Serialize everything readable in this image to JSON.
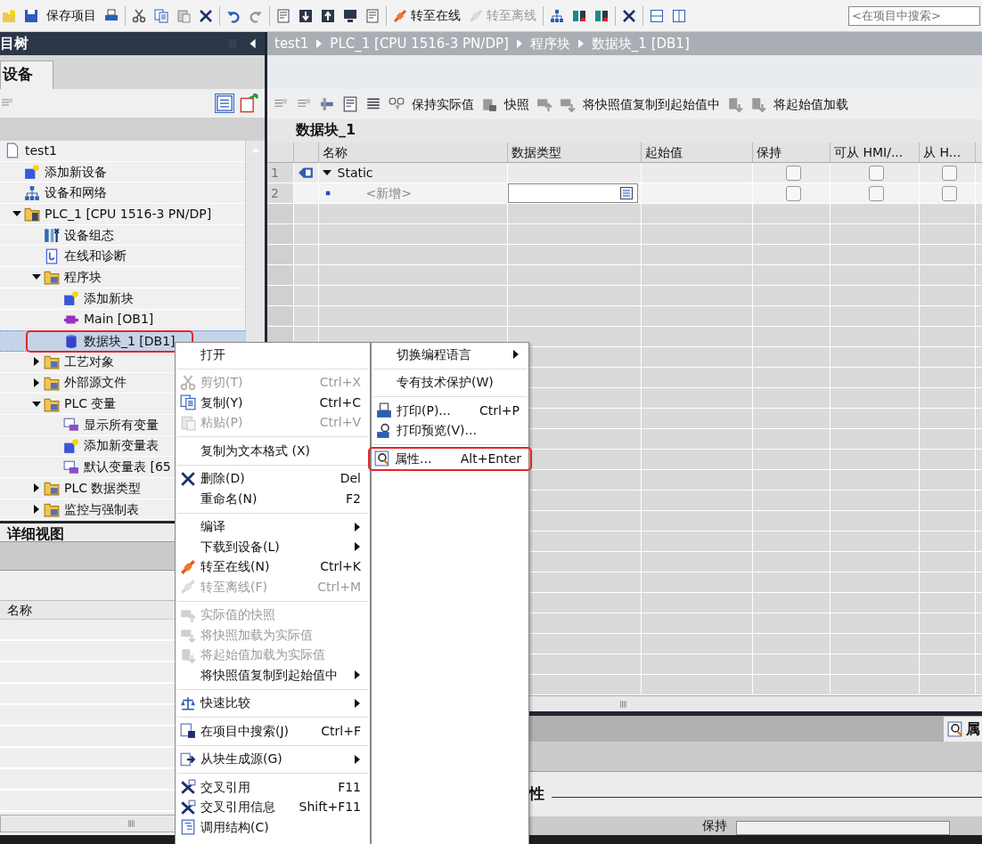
{
  "toolbar": {
    "buttons": [
      {
        "label": "保存项目",
        "disabled": false
      },
      {
        "label": "转至在线",
        "disabled": false
      },
      {
        "label": "转至离线",
        "disabled": true
      }
    ],
    "search": {
      "placeholder": "<在项目中搜索>"
    }
  },
  "project_tree": {
    "title": "目树",
    "tab": "设备",
    "items": [
      {
        "label": "test1",
        "kind": "project",
        "selected": false,
        "children": [
          {
            "label": "添加新设备",
            "kind": "add",
            "selected": false
          },
          {
            "label": "设备和网络",
            "kind": "network",
            "selected": false
          },
          {
            "label": "PLC_1 [CPU 1516-3 PN/DP]",
            "kind": "plc",
            "selected": false,
            "expanded": true,
            "children": [
              {
                "label": "设备组态",
                "kind": "config",
                "selected": false
              },
              {
                "label": "在线和诊断",
                "kind": "diag",
                "selected": false
              },
              {
                "label": "程序块",
                "kind": "folder",
                "selected": false,
                "expanded": true,
                "children": [
                  {
                    "label": "添加新块",
                    "kind": "add",
                    "selected": false
                  },
                  {
                    "label": "Main [OB1]",
                    "kind": "ob",
                    "selected": false
                  },
                  {
                    "label": "数据块_1 [DB1]",
                    "kind": "db",
                    "selected": true,
                    "highlighted": true
                  }
                ]
              },
              {
                "label": "工艺对象",
                "kind": "folder",
                "selected": false,
                "expanded": false
              },
              {
                "label": "外部源文件",
                "kind": "folder",
                "selected": false,
                "expanded": false
              },
              {
                "label": "PLC 变量",
                "kind": "folder",
                "selected": false,
                "expanded": true,
                "children": [
                  {
                    "label": "显示所有变量",
                    "kind": "tags",
                    "selected": false
                  },
                  {
                    "label": "添加新变量表",
                    "kind": "add",
                    "selected": false
                  },
                  {
                    "label": "默认变量表 [65",
                    "kind": "tags",
                    "selected": false
                  }
                ]
              },
              {
                "label": "PLC 数据类型",
                "kind": "folder",
                "selected": false,
                "expanded": false
              },
              {
                "label": "监控与强制表",
                "kind": "folder",
                "selected": false,
                "expanded": false
              }
            ]
          }
        ]
      }
    ]
  },
  "detail_view": {
    "title": "详细视图",
    "columns": [
      "名称"
    ]
  },
  "editor": {
    "breadcrumb": [
      "test1",
      "PLC_1 [CPU 1516-3 PN/DP]",
      "程序块",
      "数据块_1 [DB1]"
    ],
    "toolbar_labels": [
      "保持实际值",
      "快照",
      "将快照值复制到起始值中",
      "将起始值加载"
    ],
    "block_title": "数据块_1",
    "columns": [
      "名称",
      "数据类型",
      "起始值",
      "保持",
      "可从 HMI/...",
      "从 H..."
    ],
    "rows": [
      {
        "number": "1",
        "kind": "struct",
        "name": "Static",
        "expanded": true,
        "retain": false,
        "hmi_access": false,
        "hmi_visible": false
      },
      {
        "number": "2",
        "kind": "new",
        "name": "<新增>",
        "retain": false,
        "hmi_access": false,
        "hmi_visible": false
      }
    ]
  },
  "properties": {
    "tab": "属",
    "heading": "性",
    "field_label": "保持"
  },
  "context_menu": {
    "items": [
      {
        "kind": "item",
        "label": "打开",
        "disabled": false
      },
      {
        "kind": "separator"
      },
      {
        "kind": "item",
        "label": "剪切(T)",
        "shortcut": "Ctrl+X",
        "disabled": true
      },
      {
        "kind": "item",
        "label": "复制(Y)",
        "shortcut": "Ctrl+C",
        "disabled": false
      },
      {
        "kind": "item",
        "label": "粘贴(P)",
        "shortcut": "Ctrl+V",
        "disabled": true
      },
      {
        "kind": "separator"
      },
      {
        "kind": "item",
        "label": "复制为文本格式 (X)",
        "disabled": false
      },
      {
        "kind": "separator"
      },
      {
        "kind": "item",
        "label": "删除(D)",
        "shortcut": "Del",
        "disabled": false
      },
      {
        "kind": "item",
        "label": "重命名(N)",
        "shortcut": "F2",
        "disabled": false
      },
      {
        "kind": "separator"
      },
      {
        "kind": "item",
        "label": "编译",
        "disabled": false,
        "submenu": true
      },
      {
        "kind": "item",
        "label": "下载到设备(L)",
        "disabled": false,
        "submenu": true
      },
      {
        "kind": "item",
        "label": "转至在线(N)",
        "shortcut": "Ctrl+K",
        "disabled": false
      },
      {
        "kind": "item",
        "label": "转至离线(F)",
        "shortcut": "Ctrl+M",
        "disabled": true
      },
      {
        "kind": "separator"
      },
      {
        "kind": "item",
        "label": "实际值的快照",
        "disabled": true
      },
      {
        "kind": "item",
        "label": "将快照加载为实际值",
        "disabled": true
      },
      {
        "kind": "item",
        "label": "将起始值加载为实际值",
        "disabled": true
      },
      {
        "kind": "item",
        "label": "将快照值复制到起始值中",
        "disabled": false,
        "submenu": true
      },
      {
        "kind": "separator"
      },
      {
        "kind": "item",
        "label": "快速比较",
        "disabled": false,
        "submenu": true
      },
      {
        "kind": "separator"
      },
      {
        "kind": "item",
        "label": "在项目中搜索(J)",
        "shortcut": "Ctrl+F",
        "disabled": false
      },
      {
        "kind": "separator"
      },
      {
        "kind": "item",
        "label": "从块生成源(G)",
        "disabled": false,
        "submenu": true
      },
      {
        "kind": "separator"
      },
      {
        "kind": "item",
        "label": "交叉引用",
        "shortcut": "F11",
        "disabled": false
      },
      {
        "kind": "item",
        "label": "交叉引用信息",
        "shortcut": "Shift+F11",
        "disabled": false
      },
      {
        "kind": "item",
        "label": "调用结构(C)",
        "disabled": false
      }
    ]
  },
  "submenu": {
    "items": [
      {
        "kind": "item",
        "label": "切换编程语言",
        "disabled": false,
        "submenu": true
      },
      {
        "kind": "separator"
      },
      {
        "kind": "item",
        "label": "专有技术保护(W)",
        "disabled": false
      },
      {
        "kind": "separator"
      },
      {
        "kind": "item",
        "label": "打印(P)...",
        "shortcut": "Ctrl+P",
        "disabled": false
      },
      {
        "kind": "item",
        "label": "打印预览(V)...",
        "disabled": false
      },
      {
        "kind": "separator"
      },
      {
        "kind": "item",
        "label": "属性...",
        "shortcut": "Alt+Enter",
        "disabled": false,
        "highlighted": true
      }
    ]
  }
}
